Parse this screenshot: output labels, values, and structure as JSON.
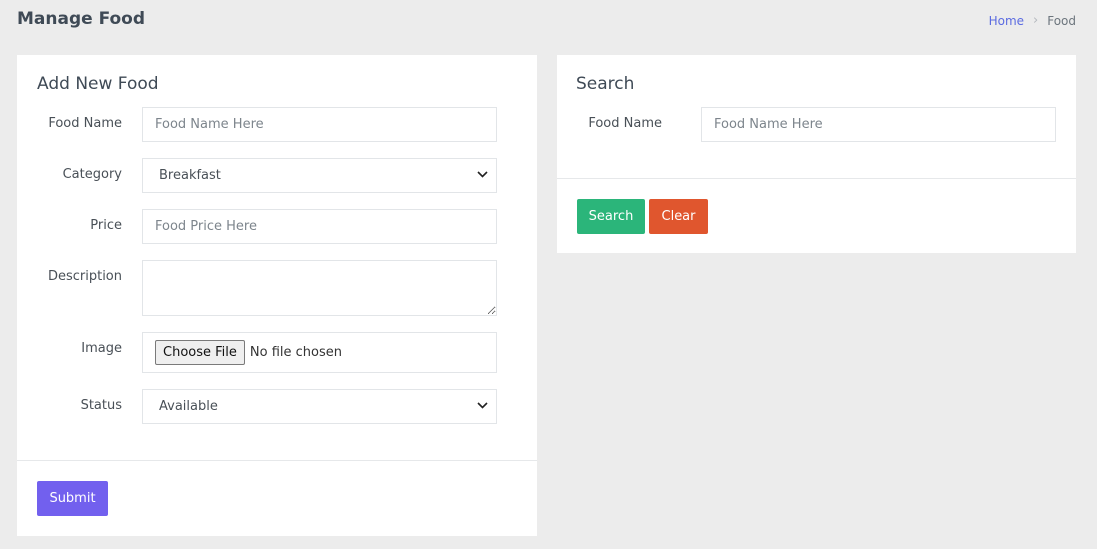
{
  "header": {
    "title": "Manage Food",
    "breadcrumb": {
      "home": "Home",
      "current": "Food"
    }
  },
  "add_form": {
    "title": "Add New Food",
    "food_name_label": "Food Name",
    "food_name_placeholder": "Food Name Here",
    "category_label": "Category",
    "category_value": "Breakfast",
    "price_label": "Price",
    "price_placeholder": "Food Price Here",
    "description_label": "Description",
    "image_label": "Image",
    "choose_file_label": "Choose File",
    "no_file_text": "No file chosen",
    "status_label": "Status",
    "status_value": "Available",
    "submit_label": "Submit"
  },
  "search_form": {
    "title": "Search",
    "food_name_label": "Food Name",
    "food_name_placeholder": "Food Name Here",
    "search_label": "Search",
    "clear_label": "Clear"
  },
  "colors": {
    "submit": "#7260ee",
    "search": "#2bb57a",
    "clear": "#e0562e",
    "link": "#5b6be1"
  },
  "icons": {
    "breadcrumb_separator": "chevron-right-icon",
    "select_arrow": "chevron-down-icon"
  }
}
